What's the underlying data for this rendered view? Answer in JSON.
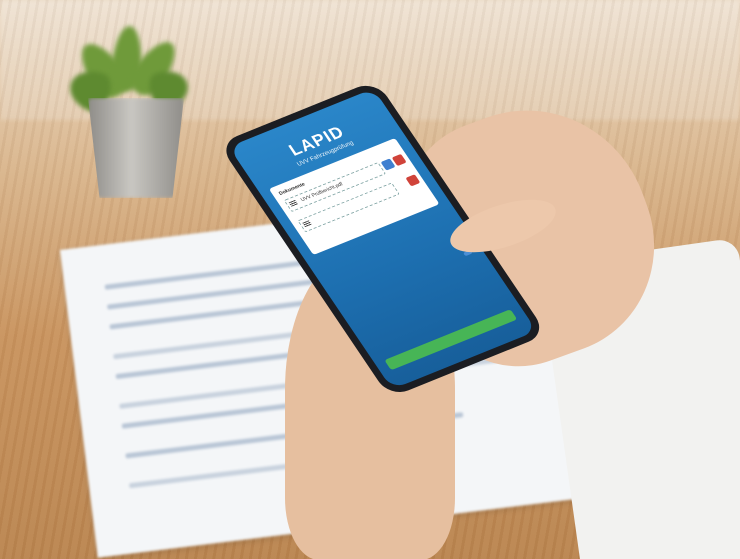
{
  "phone_screen": {
    "logo": "LAPID",
    "subtitle": "UVV Fahrzeugprüfung",
    "body_text": "",
    "card": {
      "title": "Dokumente",
      "rows": [
        {
          "label": "UVV Prüfbericht.pdf"
        },
        {
          "label": ""
        }
      ]
    },
    "add_button_label": "",
    "submit_label": ""
  },
  "colors": {
    "screen_top": "#2a86c9",
    "screen_bottom": "#175f9b",
    "button_blue": "#3f7fd0",
    "button_red": "#d0433a",
    "button_green": "#47b556"
  }
}
